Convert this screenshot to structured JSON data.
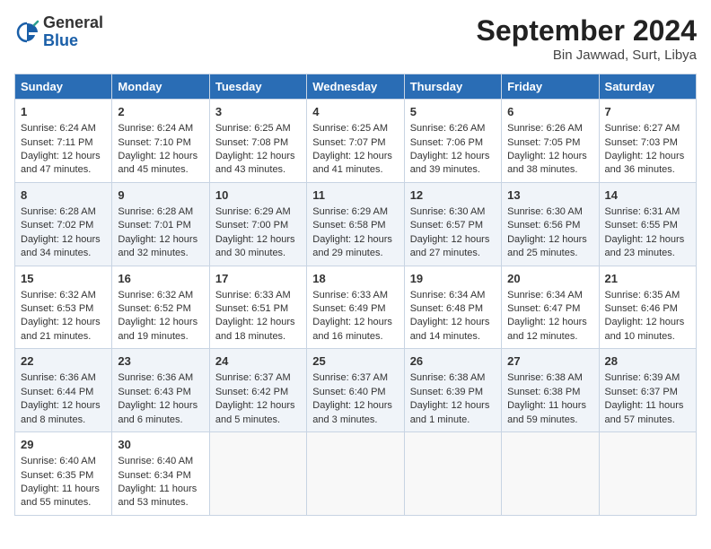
{
  "header": {
    "logo_general": "General",
    "logo_blue": "Blue",
    "month_title": "September 2024",
    "location": "Bin Jawwad, Surt, Libya"
  },
  "days_of_week": [
    "Sunday",
    "Monday",
    "Tuesday",
    "Wednesday",
    "Thursday",
    "Friday",
    "Saturday"
  ],
  "weeks": [
    [
      {
        "day": 1,
        "sunrise": "6:24 AM",
        "sunset": "7:11 PM",
        "daylight": "12 hours and 47 minutes."
      },
      {
        "day": 2,
        "sunrise": "6:24 AM",
        "sunset": "7:10 PM",
        "daylight": "12 hours and 45 minutes."
      },
      {
        "day": 3,
        "sunrise": "6:25 AM",
        "sunset": "7:08 PM",
        "daylight": "12 hours and 43 minutes."
      },
      {
        "day": 4,
        "sunrise": "6:25 AM",
        "sunset": "7:07 PM",
        "daylight": "12 hours and 41 minutes."
      },
      {
        "day": 5,
        "sunrise": "6:26 AM",
        "sunset": "7:06 PM",
        "daylight": "12 hours and 39 minutes."
      },
      {
        "day": 6,
        "sunrise": "6:26 AM",
        "sunset": "7:05 PM",
        "daylight": "12 hours and 38 minutes."
      },
      {
        "day": 7,
        "sunrise": "6:27 AM",
        "sunset": "7:03 PM",
        "daylight": "12 hours and 36 minutes."
      }
    ],
    [
      {
        "day": 8,
        "sunrise": "6:28 AM",
        "sunset": "7:02 PM",
        "daylight": "12 hours and 34 minutes."
      },
      {
        "day": 9,
        "sunrise": "6:28 AM",
        "sunset": "7:01 PM",
        "daylight": "12 hours and 32 minutes."
      },
      {
        "day": 10,
        "sunrise": "6:29 AM",
        "sunset": "7:00 PM",
        "daylight": "12 hours and 30 minutes."
      },
      {
        "day": 11,
        "sunrise": "6:29 AM",
        "sunset": "6:58 PM",
        "daylight": "12 hours and 29 minutes."
      },
      {
        "day": 12,
        "sunrise": "6:30 AM",
        "sunset": "6:57 PM",
        "daylight": "12 hours and 27 minutes."
      },
      {
        "day": 13,
        "sunrise": "6:30 AM",
        "sunset": "6:56 PM",
        "daylight": "12 hours and 25 minutes."
      },
      {
        "day": 14,
        "sunrise": "6:31 AM",
        "sunset": "6:55 PM",
        "daylight": "12 hours and 23 minutes."
      }
    ],
    [
      {
        "day": 15,
        "sunrise": "6:32 AM",
        "sunset": "6:53 PM",
        "daylight": "12 hours and 21 minutes."
      },
      {
        "day": 16,
        "sunrise": "6:32 AM",
        "sunset": "6:52 PM",
        "daylight": "12 hours and 19 minutes."
      },
      {
        "day": 17,
        "sunrise": "6:33 AM",
        "sunset": "6:51 PM",
        "daylight": "12 hours and 18 minutes."
      },
      {
        "day": 18,
        "sunrise": "6:33 AM",
        "sunset": "6:49 PM",
        "daylight": "12 hours and 16 minutes."
      },
      {
        "day": 19,
        "sunrise": "6:34 AM",
        "sunset": "6:48 PM",
        "daylight": "12 hours and 14 minutes."
      },
      {
        "day": 20,
        "sunrise": "6:34 AM",
        "sunset": "6:47 PM",
        "daylight": "12 hours and 12 minutes."
      },
      {
        "day": 21,
        "sunrise": "6:35 AM",
        "sunset": "6:46 PM",
        "daylight": "12 hours and 10 minutes."
      }
    ],
    [
      {
        "day": 22,
        "sunrise": "6:36 AM",
        "sunset": "6:44 PM",
        "daylight": "12 hours and 8 minutes."
      },
      {
        "day": 23,
        "sunrise": "6:36 AM",
        "sunset": "6:43 PM",
        "daylight": "12 hours and 6 minutes."
      },
      {
        "day": 24,
        "sunrise": "6:37 AM",
        "sunset": "6:42 PM",
        "daylight": "12 hours and 5 minutes."
      },
      {
        "day": 25,
        "sunrise": "6:37 AM",
        "sunset": "6:40 PM",
        "daylight": "12 hours and 3 minutes."
      },
      {
        "day": 26,
        "sunrise": "6:38 AM",
        "sunset": "6:39 PM",
        "daylight": "12 hours and 1 minute."
      },
      {
        "day": 27,
        "sunrise": "6:38 AM",
        "sunset": "6:38 PM",
        "daylight": "11 hours and 59 minutes."
      },
      {
        "day": 28,
        "sunrise": "6:39 AM",
        "sunset": "6:37 PM",
        "daylight": "11 hours and 57 minutes."
      }
    ],
    [
      {
        "day": 29,
        "sunrise": "6:40 AM",
        "sunset": "6:35 PM",
        "daylight": "11 hours and 55 minutes."
      },
      {
        "day": 30,
        "sunrise": "6:40 AM",
        "sunset": "6:34 PM",
        "daylight": "11 hours and 53 minutes."
      },
      null,
      null,
      null,
      null,
      null
    ]
  ],
  "labels": {
    "sunrise": "Sunrise:",
    "sunset": "Sunset:",
    "daylight": "Daylight:"
  }
}
